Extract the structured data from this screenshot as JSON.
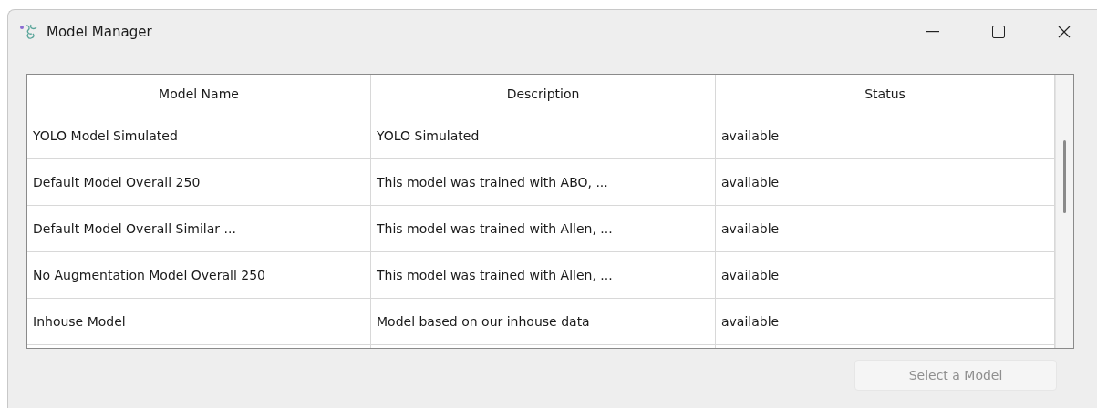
{
  "window": {
    "title": "Model Manager"
  },
  "table": {
    "columns": [
      "Model Name",
      "Description",
      "Status"
    ],
    "rows": [
      {
        "cells": [
          "YOLO Model Simulated",
          "YOLO Simulated",
          "available"
        ]
      },
      {
        "cells": [
          "Default Model Overall 250",
          "This model was trained with ABO, ...",
          "available"
        ]
      },
      {
        "cells": [
          "Default Model Overall Similar ...",
          "This model was trained with Allen, ...",
          "available"
        ]
      },
      {
        "cells": [
          "No Augmentation Model Overall 250",
          "This model was trained with Allen, ...",
          "available"
        ]
      },
      {
        "cells": [
          "Inhouse Model",
          "Model based on our inhouse data",
          "available"
        ]
      }
    ]
  },
  "select_button": {
    "label": "Select a Model",
    "disabled": true
  }
}
